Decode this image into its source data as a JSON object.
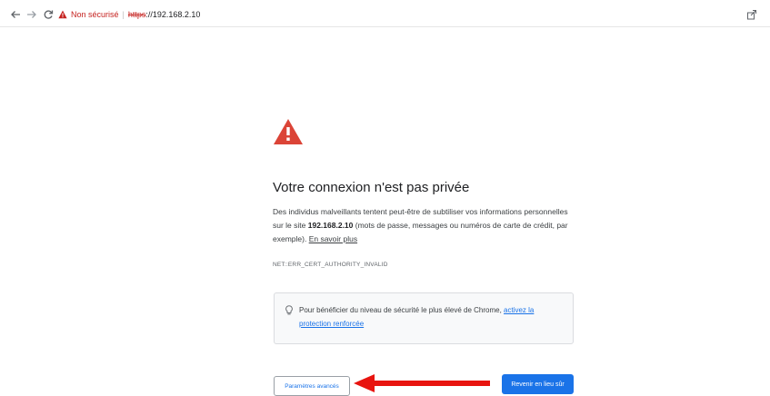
{
  "toolbar": {
    "not_secure_label": "Non sécurisé",
    "separator": "|",
    "scheme": "https",
    "host": "://192.168.2.10",
    "icons": [
      "back-arrow-icon",
      "forward-arrow-icon",
      "reload-icon",
      "warning-triangle-icon",
      "share-icon"
    ]
  },
  "page": {
    "title": "Votre connexion n'est pas privée",
    "desc_part1": "Des individus malveillants tentent peut-être de subtiliser vos informations personnelles sur le site ",
    "desc_host": "192.168.2.10",
    "desc_part2": " (mots de passe, messages ou numéros de carte de crédit, par exemple). ",
    "learn_more": "En savoir plus",
    "error_code": "NET::ERR_CERT_AUTHORITY_INVALID",
    "info_text": "Pour bénéficier du niveau de sécurité le plus élevé de Chrome, ",
    "info_link": "activez la protection renforcée",
    "advanced_button": "Paramètres avancés",
    "back_button": "Revenir en lieu sûr"
  },
  "colors": {
    "warning_red": "#db4437",
    "link_blue": "#1a73e8",
    "arrow_red": "#e8140f"
  }
}
